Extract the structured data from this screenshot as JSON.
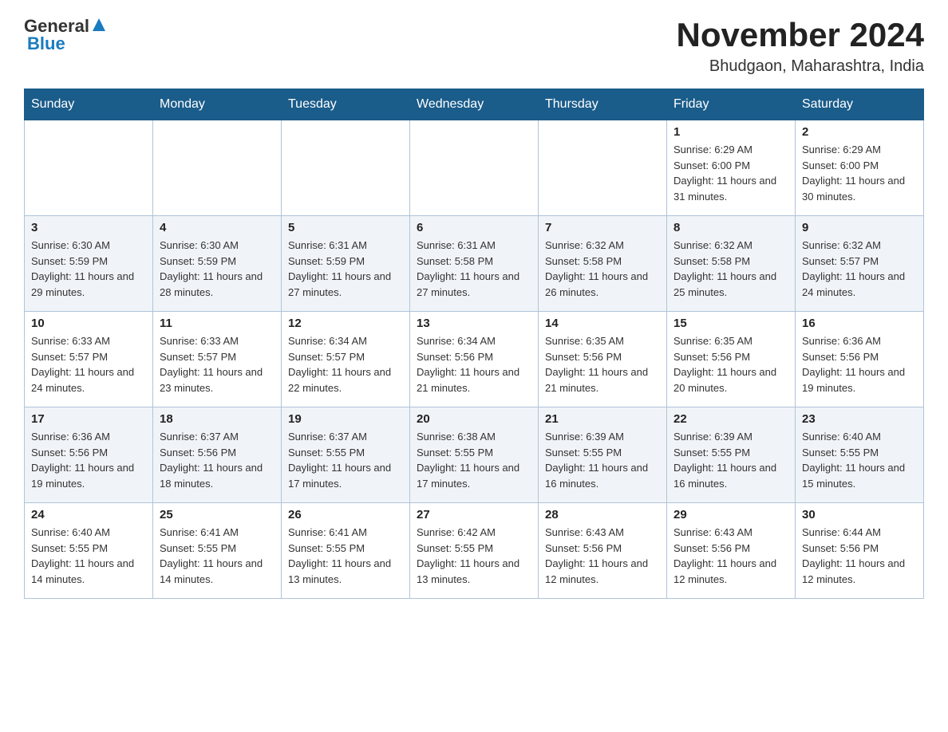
{
  "header": {
    "logo": {
      "general": "General",
      "blue": "Blue"
    },
    "month_title": "November 2024",
    "location": "Bhudgaon, Maharashtra, India"
  },
  "weekdays": [
    "Sunday",
    "Monday",
    "Tuesday",
    "Wednesday",
    "Thursday",
    "Friday",
    "Saturday"
  ],
  "weeks": [
    [
      {
        "day": "",
        "info": ""
      },
      {
        "day": "",
        "info": ""
      },
      {
        "day": "",
        "info": ""
      },
      {
        "day": "",
        "info": ""
      },
      {
        "day": "",
        "info": ""
      },
      {
        "day": "1",
        "info": "Sunrise: 6:29 AM\nSunset: 6:00 PM\nDaylight: 11 hours and 31 minutes."
      },
      {
        "day": "2",
        "info": "Sunrise: 6:29 AM\nSunset: 6:00 PM\nDaylight: 11 hours and 30 minutes."
      }
    ],
    [
      {
        "day": "3",
        "info": "Sunrise: 6:30 AM\nSunset: 5:59 PM\nDaylight: 11 hours and 29 minutes."
      },
      {
        "day": "4",
        "info": "Sunrise: 6:30 AM\nSunset: 5:59 PM\nDaylight: 11 hours and 28 minutes."
      },
      {
        "day": "5",
        "info": "Sunrise: 6:31 AM\nSunset: 5:59 PM\nDaylight: 11 hours and 27 minutes."
      },
      {
        "day": "6",
        "info": "Sunrise: 6:31 AM\nSunset: 5:58 PM\nDaylight: 11 hours and 27 minutes."
      },
      {
        "day": "7",
        "info": "Sunrise: 6:32 AM\nSunset: 5:58 PM\nDaylight: 11 hours and 26 minutes."
      },
      {
        "day": "8",
        "info": "Sunrise: 6:32 AM\nSunset: 5:58 PM\nDaylight: 11 hours and 25 minutes."
      },
      {
        "day": "9",
        "info": "Sunrise: 6:32 AM\nSunset: 5:57 PM\nDaylight: 11 hours and 24 minutes."
      }
    ],
    [
      {
        "day": "10",
        "info": "Sunrise: 6:33 AM\nSunset: 5:57 PM\nDaylight: 11 hours and 24 minutes."
      },
      {
        "day": "11",
        "info": "Sunrise: 6:33 AM\nSunset: 5:57 PM\nDaylight: 11 hours and 23 minutes."
      },
      {
        "day": "12",
        "info": "Sunrise: 6:34 AM\nSunset: 5:57 PM\nDaylight: 11 hours and 22 minutes."
      },
      {
        "day": "13",
        "info": "Sunrise: 6:34 AM\nSunset: 5:56 PM\nDaylight: 11 hours and 21 minutes."
      },
      {
        "day": "14",
        "info": "Sunrise: 6:35 AM\nSunset: 5:56 PM\nDaylight: 11 hours and 21 minutes."
      },
      {
        "day": "15",
        "info": "Sunrise: 6:35 AM\nSunset: 5:56 PM\nDaylight: 11 hours and 20 minutes."
      },
      {
        "day": "16",
        "info": "Sunrise: 6:36 AM\nSunset: 5:56 PM\nDaylight: 11 hours and 19 minutes."
      }
    ],
    [
      {
        "day": "17",
        "info": "Sunrise: 6:36 AM\nSunset: 5:56 PM\nDaylight: 11 hours and 19 minutes."
      },
      {
        "day": "18",
        "info": "Sunrise: 6:37 AM\nSunset: 5:56 PM\nDaylight: 11 hours and 18 minutes."
      },
      {
        "day": "19",
        "info": "Sunrise: 6:37 AM\nSunset: 5:55 PM\nDaylight: 11 hours and 17 minutes."
      },
      {
        "day": "20",
        "info": "Sunrise: 6:38 AM\nSunset: 5:55 PM\nDaylight: 11 hours and 17 minutes."
      },
      {
        "day": "21",
        "info": "Sunrise: 6:39 AM\nSunset: 5:55 PM\nDaylight: 11 hours and 16 minutes."
      },
      {
        "day": "22",
        "info": "Sunrise: 6:39 AM\nSunset: 5:55 PM\nDaylight: 11 hours and 16 minutes."
      },
      {
        "day": "23",
        "info": "Sunrise: 6:40 AM\nSunset: 5:55 PM\nDaylight: 11 hours and 15 minutes."
      }
    ],
    [
      {
        "day": "24",
        "info": "Sunrise: 6:40 AM\nSunset: 5:55 PM\nDaylight: 11 hours and 14 minutes."
      },
      {
        "day": "25",
        "info": "Sunrise: 6:41 AM\nSunset: 5:55 PM\nDaylight: 11 hours and 14 minutes."
      },
      {
        "day": "26",
        "info": "Sunrise: 6:41 AM\nSunset: 5:55 PM\nDaylight: 11 hours and 13 minutes."
      },
      {
        "day": "27",
        "info": "Sunrise: 6:42 AM\nSunset: 5:55 PM\nDaylight: 11 hours and 13 minutes."
      },
      {
        "day": "28",
        "info": "Sunrise: 6:43 AM\nSunset: 5:56 PM\nDaylight: 11 hours and 12 minutes."
      },
      {
        "day": "29",
        "info": "Sunrise: 6:43 AM\nSunset: 5:56 PM\nDaylight: 11 hours and 12 minutes."
      },
      {
        "day": "30",
        "info": "Sunrise: 6:44 AM\nSunset: 5:56 PM\nDaylight: 11 hours and 12 minutes."
      }
    ]
  ]
}
